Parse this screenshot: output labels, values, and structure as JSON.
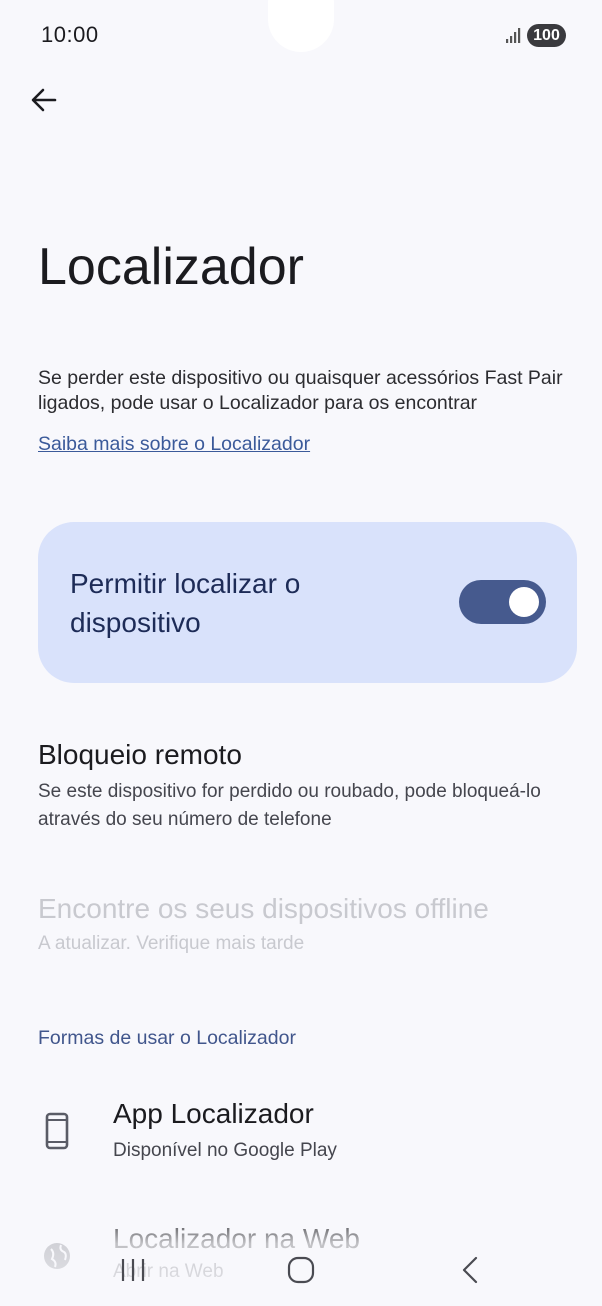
{
  "status_bar": {
    "time": "10:00",
    "battery": "100",
    "signal_icon": "signal-bars-icon"
  },
  "header": {
    "back_icon": "arrow-back-icon"
  },
  "page": {
    "title": "Localizador",
    "description": "Se perder este dispositivo ou quaisquer acessórios Fast Pair ligados, pode usar o Localizador para os encontrar",
    "learn_more": "Saiba mais sobre o Localizador"
  },
  "main_toggle": {
    "label": "Permitir localizar o dispositivo",
    "enabled": true,
    "accent_color": "#465a8e",
    "card_color": "#d9e2fb"
  },
  "items": {
    "remote_lock": {
      "title": "Bloqueio remoto",
      "subtitle": "Se este dispositivo for perdido ou roubado, pode bloqueá-lo através do seu número de telefone"
    },
    "offline_devices": {
      "title": "Encontre os seus dispositivos offline",
      "subtitle": "A atualizar. Verifique mais tarde",
      "disabled": true
    }
  },
  "section": {
    "header": "Formas de usar o Localizador",
    "entries": [
      {
        "title": "App Localizador",
        "subtitle": "Disponível no Google Play",
        "icon": "phone-icon"
      },
      {
        "title": "Localizador na Web",
        "subtitle": "Abrir na Web",
        "icon": "globe-icon"
      }
    ]
  },
  "nav_bar": {
    "recents_icon": "recents-icon",
    "home_icon": "home-icon",
    "back_icon": "nav-back-icon"
  }
}
